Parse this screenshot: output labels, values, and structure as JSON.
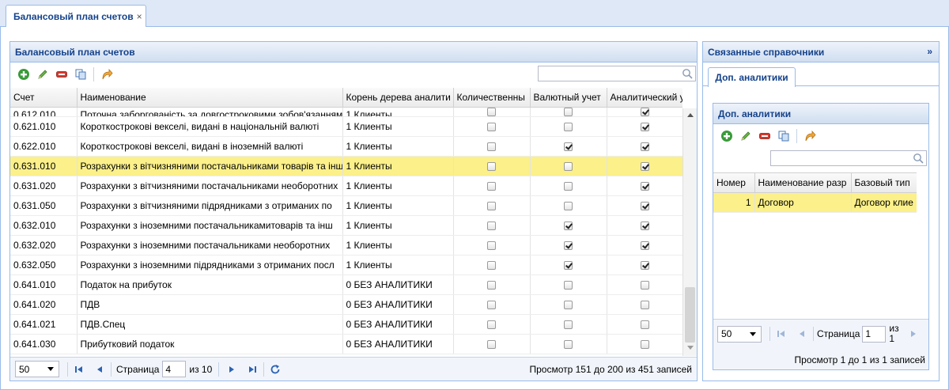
{
  "tab": {
    "title": "Балансовый план счетов",
    "close": "×"
  },
  "left": {
    "title": "Балансовый план счетов",
    "search_placeholder": "",
    "columns": [
      "Счет",
      "Наименование",
      "Корень дерева аналити",
      "Количественны",
      "Валютный учет",
      "Аналитический у"
    ],
    "rows": [
      {
        "account": "0.612.010",
        "name": "Поточна заборгованість за довгостроковими зобов'язаннями",
        "root": "1 Клиенты",
        "qty": false,
        "cur": false,
        "anal": true
      },
      {
        "account": "0.621.010",
        "name": "Короткострокові векселі, видані в національній валюті",
        "root": "1 Клиенты",
        "qty": false,
        "cur": false,
        "anal": true
      },
      {
        "account": "0.622.010",
        "name": "Короткострокові векселі, видані в іноземній валюті",
        "root": "1 Клиенты",
        "qty": false,
        "cur": true,
        "anal": true
      },
      {
        "account": "0.631.010",
        "name": "Розрахунки з вітчизняними постачальниками товарів та інших",
        "root": "1 Клиенты",
        "qty": false,
        "cur": false,
        "anal": true,
        "selected": true
      },
      {
        "account": "0.631.020",
        "name": "Розрахунки з вітчизняними постачальниками необоротних",
        "root": "1 Клиенты",
        "qty": false,
        "cur": false,
        "anal": true
      },
      {
        "account": "0.631.050",
        "name": "Розрахунки з вітчизняними підрядниками з отриманих по",
        "root": "1 Клиенты",
        "qty": false,
        "cur": false,
        "anal": true
      },
      {
        "account": "0.632.010",
        "name": "Розрахунки з іноземними постачальникамитоварів та інш",
        "root": "1 Клиенты",
        "qty": false,
        "cur": true,
        "anal": true
      },
      {
        "account": "0.632.020",
        "name": "Розрахунки з іноземними постачальниками необоротних",
        "root": "1 Клиенты",
        "qty": false,
        "cur": true,
        "anal": true
      },
      {
        "account": "0.632.050",
        "name": "Розрахунки з іноземними підрядниками з отриманих посл",
        "root": "1 Клиенты",
        "qty": false,
        "cur": true,
        "anal": true
      },
      {
        "account": "0.641.010",
        "name": "Податок на прибуток",
        "root": "0 БЕЗ АНАЛИТИКИ",
        "qty": false,
        "cur": false,
        "anal": false
      },
      {
        "account": "0.641.020",
        "name": "ПДВ",
        "root": "0 БЕЗ АНАЛИТИКИ",
        "qty": false,
        "cur": false,
        "anal": false
      },
      {
        "account": "0.641.021",
        "name": "ПДВ.Спец",
        "root": "0 БЕЗ АНАЛИТИКИ",
        "qty": false,
        "cur": false,
        "anal": false
      },
      {
        "account": "0.641.030",
        "name": "Прибутковий податок",
        "root": "0 БЕЗ АНАЛИТИКИ",
        "qty": false,
        "cur": false,
        "anal": false
      }
    ],
    "pager": {
      "page_size": "50",
      "page_label": "Страница",
      "page": "4",
      "of": "из 10",
      "summary": "Просмотр 151 до 200 из 451 записей"
    }
  },
  "right": {
    "title": "Связанные справочники",
    "subtab": "Доп. аналитики",
    "inner_title": "Доп. аналитики",
    "columns": [
      "Номер",
      "Наименование разр",
      "Базовый тип"
    ],
    "rows": [
      {
        "num": "1",
        "name": "Договор",
        "type": "Договор клие"
      }
    ],
    "pager": {
      "page_size": "50",
      "page_label": "Страница",
      "page": "1",
      "of_label": "из",
      "of_value": "1",
      "summary": "Просмотр 1 до 1 из 1 записей"
    }
  },
  "colors": {
    "accent": "#15428b",
    "border": "#99bbe8",
    "selected": "#fbf08a"
  }
}
